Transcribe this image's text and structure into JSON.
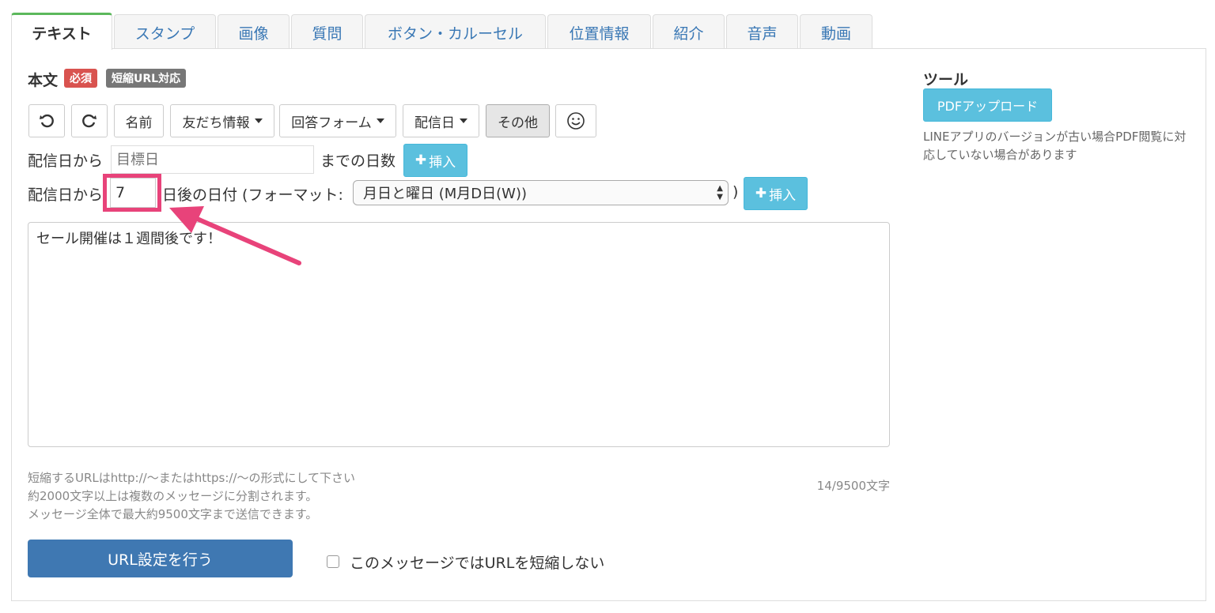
{
  "tabs": [
    {
      "label": "テキスト",
      "active": true
    },
    {
      "label": "スタンプ",
      "active": false
    },
    {
      "label": "画像",
      "active": false
    },
    {
      "label": "質問",
      "active": false
    },
    {
      "label": "ボタン・カルーセル",
      "active": false
    },
    {
      "label": "位置情報",
      "active": false
    },
    {
      "label": "紹介",
      "active": false
    },
    {
      "label": "音声",
      "active": false
    },
    {
      "label": "動画",
      "active": false
    }
  ],
  "body_section": {
    "title": "本文",
    "badge_required": "必須",
    "badge_short_url": "短縮URL対応"
  },
  "toolbar": {
    "undo_icon": "undo-icon",
    "redo_icon": "redo-icon",
    "name": "名前",
    "friend_info": "友だち情報",
    "answer_form": "回答フォーム",
    "delivery_date": "配信日",
    "other": "その他",
    "emoji_icon": "smiley-icon"
  },
  "row_days_until": {
    "prefix": "配信日から",
    "placeholder": "目標日",
    "suffix": "までの日数",
    "insert": "挿入"
  },
  "row_date_after": {
    "prefix": "配信日から",
    "days_value": "7",
    "suffix": "日後の日付 (フォーマット:",
    "format_selected": "月日と曜日 (M月D日(W))",
    "close_paren": ")",
    "insert": "挿入"
  },
  "message_text": "セール開催は１週間後です！",
  "help_lines": [
    "短縮するURLはhttp://〜またはhttps://〜の形式にして下さい",
    "約2000文字以上は複数のメッセージに分割されます。",
    "メッセージ全体で最大約9500文字まで送信できます。"
  ],
  "char_counter": "14/9500文字",
  "url_button": "URL設定を行う",
  "no_shorten_label": "このメッセージではURLを短縮しない",
  "tools": {
    "title": "ツール",
    "pdf_upload": "PDFアップロード",
    "note": "LINEアプリのバージョンが古い場合PDF閲覧に対応していない場合があります"
  },
  "colors": {
    "highlight": "#e8437a",
    "info_button": "#5bc0de",
    "primary_button": "#3f78b2",
    "required_badge": "#d9534f",
    "active_tab_top": "#5cb85c"
  }
}
